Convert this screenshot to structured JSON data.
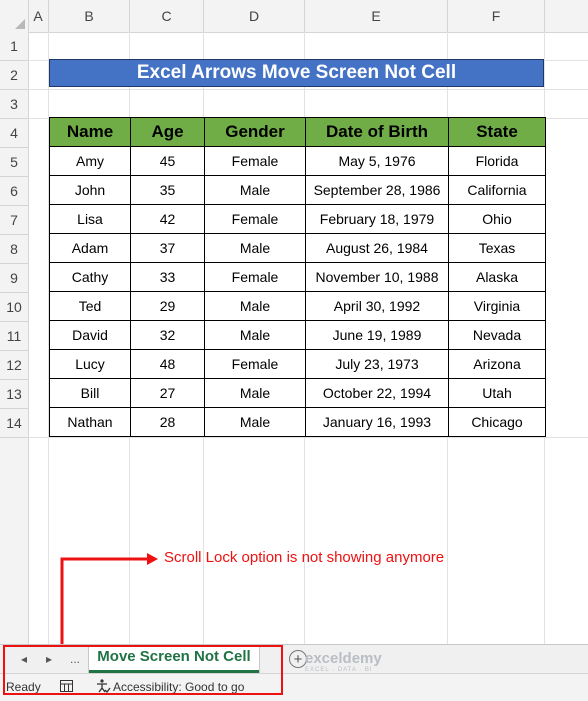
{
  "spreadsheet": {
    "columns": [
      "A",
      "B",
      "C",
      "D",
      "E",
      "F"
    ],
    "rows": [
      "1",
      "2",
      "3",
      "4",
      "5",
      "6",
      "7",
      "8",
      "9",
      "10",
      "11",
      "12",
      "13",
      "14"
    ]
  },
  "title": "Excel Arrows Move Screen Not Cell",
  "table": {
    "headers": [
      "Name",
      "Age",
      "Gender",
      "Date of Birth",
      "State"
    ],
    "rows": [
      [
        "Amy",
        "45",
        "Female",
        "May 5, 1976",
        "Florida"
      ],
      [
        "John",
        "35",
        "Male",
        "September 28, 1986",
        "California"
      ],
      [
        "Lisa",
        "42",
        "Female",
        "February 18, 1979",
        "Ohio"
      ],
      [
        "Adam",
        "37",
        "Male",
        "August 26, 1984",
        "Texas"
      ],
      [
        "Cathy",
        "33",
        "Female",
        "November 10, 1988",
        "Alaska"
      ],
      [
        "Ted",
        "29",
        "Male",
        "April 30, 1992",
        "Virginia"
      ],
      [
        "David",
        "32",
        "Male",
        "June 19, 1989",
        "Nevada"
      ],
      [
        "Lucy",
        "48",
        "Female",
        "July 23, 1973",
        "Arizona"
      ],
      [
        "Bill",
        "27",
        "Male",
        "October 22, 1994",
        "Utah"
      ],
      [
        "Nathan",
        "28",
        "Male",
        "January 16, 1993",
        "Chicago"
      ]
    ]
  },
  "annotation": "Scroll Lock option is not showing anymore",
  "tabs": {
    "prev_icon": "◂",
    "next_icon": "▸",
    "more": "...",
    "sheet": "Move Screen Not Cell",
    "add_icon": "+"
  },
  "watermark": {
    "name": "exceldemy",
    "tagline": "EXCEL · DATA · BI"
  },
  "status": {
    "ready": "Ready",
    "accessibility": "Accessibility: Good to go"
  },
  "colors": {
    "title_bg": "#4472c4",
    "header_bg": "#70ad47",
    "annotation": "#ee1111",
    "tab_accent": "#217346"
  }
}
